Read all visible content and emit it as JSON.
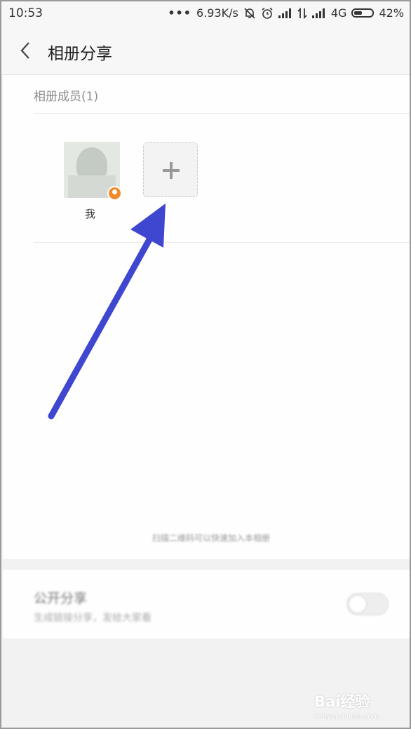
{
  "status_bar": {
    "time": "10:53",
    "dots": "•••",
    "net_speed": "6.93K/s",
    "network": "4G",
    "battery": "42%"
  },
  "header": {
    "title": "相册分享",
    "back_icon": "chevron-left-icon"
  },
  "members": {
    "section_label": "相册成员(1)",
    "items": [
      {
        "label": "我",
        "role_icon": "owner-badge-icon"
      }
    ],
    "add_icon": "plus-icon"
  },
  "hint_text": "扫描二维码可以快速加入本相册",
  "public_share": {
    "title": "公开分享",
    "description": "生成链接分享，发给大家看"
  },
  "watermark": {
    "brand": "Bai经验",
    "url": "jingyan.baidu.com"
  },
  "colors": {
    "arrow": "#3f46cf",
    "badge": "#f08a2a"
  }
}
